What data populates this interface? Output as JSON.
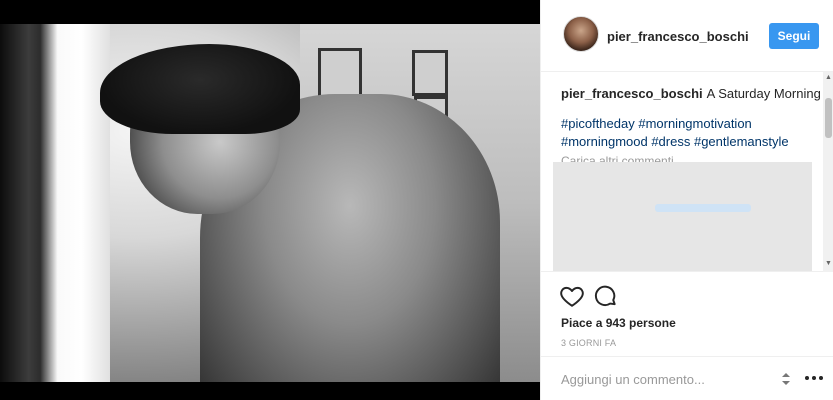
{
  "post": {
    "username": "pier_francesco_boschi",
    "follow_label": "Segui",
    "caption_user": "pier_francesco_boschi",
    "caption_text": "A Saturday Morning",
    "hashtags": "#picoftheday #morningmotivation #morningmood #dress #gentlemanstyle",
    "load_more_label": "Carica altri commenti",
    "likes_text": "Piace a 943 persone",
    "timestamp": "3 GIORNI FA"
  },
  "actions": {
    "like_icon": "heart-icon",
    "comment_icon": "comment-icon",
    "more_icon": "more-options-icon"
  },
  "comment_input": {
    "placeholder": "Aggiungi un commento..."
  },
  "colors": {
    "follow_button": "#3897f0",
    "hashtag": "#003569",
    "muted_text": "#999999"
  }
}
